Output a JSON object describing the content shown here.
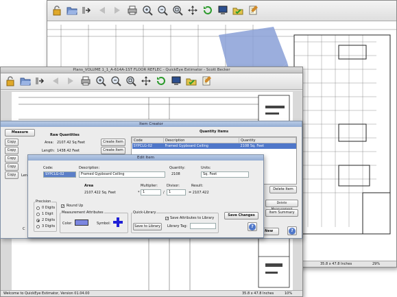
{
  "back_window": {
    "size_label": "35.8 x 47.8 Inches",
    "zoom_label": "29%"
  },
  "main_window": {
    "title": "Plans_VOLUME 1_1_A-614A-1ST FLOOR REFLEC - QuickEye Estimator - Scott Becker",
    "status_text": "Welcome to QuickEye Estimator, Version 01.04.00",
    "size_label": "35.8 x 47.8 Inches",
    "zoom_label": "10%"
  },
  "toolbar_icons": [
    "lock-icon",
    "folder-open-icon",
    "import-icon",
    "back-arrow-icon",
    "forward-arrow-icon",
    "print-icon",
    "zoom-in-icon",
    "zoom-out-icon",
    "zoom-fit-icon",
    "pan-icon",
    "refresh-icon",
    "computer-icon",
    "folder-check-icon",
    "notes-icon"
  ],
  "item_creator": {
    "title": "Item Creator",
    "measure_label": "Measure",
    "copy_label": "Copy",
    "raw_quantities_title": "Raw Quantities",
    "area_label": "Area:",
    "area_value": "2107.42 Sq Feet",
    "length_label": "Length:",
    "length_value": "1438.42 Feet",
    "leng_partial": "Leng",
    "create_item_label": "Create Item",
    "quantity_items_title": "Quantity Items",
    "columns": [
      "Code",
      "Description",
      "Quantity"
    ],
    "rows": [
      {
        "code": "SYPCLG-02",
        "description": "Framed Gypboard Ceiling",
        "quantity": "2108 Sq. Feet"
      }
    ],
    "delete_item_label": "Delete Item",
    "delete_measurement_label": "Delete Measurement",
    "item_summary_label": "Item Summary",
    "new_label": "New",
    "partial_c": "C"
  },
  "edit_item": {
    "title": "Edit Item",
    "code_label": "Code:",
    "code_value": "SYPCLG-02",
    "description_label": "Description:",
    "description_value": "Framed Gypboard Ceiling",
    "quantity_label": "Quantity:",
    "quantity_value": "2108",
    "units_label": "Units:",
    "units_value": "Sq. Feet",
    "area_title": "Area",
    "area_value": "2107.422 Sq. Feet",
    "multiplier_label": "Multiplier:",
    "multiplier_value": "1",
    "divisor_label": "Divisor:",
    "divisor_value": "1",
    "result_label": "Result:",
    "result_value": "= 2107.422",
    "times_sign": "*",
    "slash_sign": "/",
    "precision_title": "Precision",
    "precision_options": [
      "0 Digits",
      "1 Digit",
      "2 Digits",
      "3 Digits"
    ],
    "precision_selected": 2,
    "round_up_label": "Round Up",
    "measurement_attributes_title": "Measurement Attributes",
    "color_label": "Color:",
    "color_value": "#7b86e0",
    "symbol_label": "Symbol:",
    "symbol_color": "#1f1fd6",
    "quick_library_title": "Quick-Library",
    "save_to_library_label": "Save to Library",
    "save_attributes_label": "Save Attributes to Library",
    "library_tag_label": "Library Tag:",
    "library_tag_value": "",
    "save_changes_label": "Save Changes",
    "help_label": "?"
  }
}
